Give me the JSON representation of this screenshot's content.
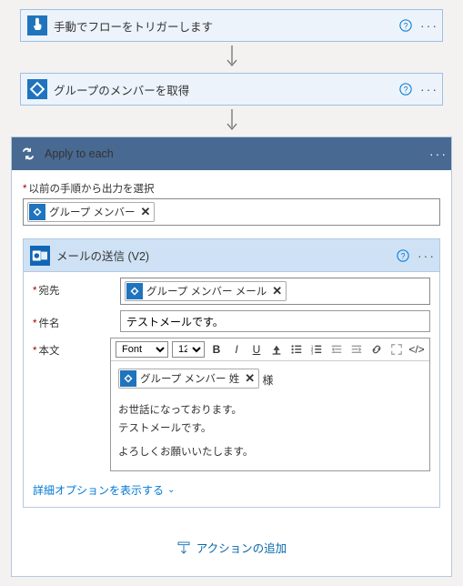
{
  "steps": {
    "trigger": {
      "title": "手動でフローをトリガーします"
    },
    "getMembers": {
      "title": "グループのメンバーを取得"
    }
  },
  "applyToEach": {
    "title": "Apply to each",
    "inputLabel": "以前の手順から出力を選択",
    "token": "グループ メンバー"
  },
  "sendMail": {
    "title": "メールの送信 (V2)",
    "fields": {
      "to": {
        "label": "宛先",
        "token": "グループ メンバー メール"
      },
      "subject": {
        "label": "件名",
        "value": "テストメールです。"
      },
      "body": {
        "label": "本文",
        "token": "グループ メンバー 姓",
        "tokenSuffix": " 様",
        "line1": "お世話になっております。",
        "line2": "テストメールです。",
        "line3": "よろしくお願いいたします。"
      }
    },
    "rte": {
      "fontLabel": "Font",
      "sizeLabel": "12"
    },
    "advancedLink": "詳細オプションを表示する"
  },
  "addAction": "アクションの追加"
}
